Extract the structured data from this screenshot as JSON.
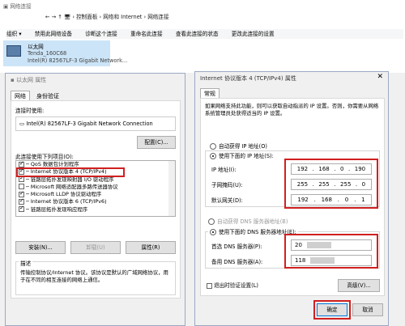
{
  "explorer": {
    "title": "网络连接",
    "breadcrumb": [
      "控制面板",
      "网络和 Internet",
      "网络连接"
    ],
    "toolbar": [
      "组织 ▾",
      "禁用此网络设备",
      "诊断这个连接",
      "重命名此连接",
      "查看此连接的状态",
      "更改此连接的设置"
    ],
    "adapter": {
      "name": "以太网",
      "network": "Tenda_160C68",
      "device": "Intel(R) 82567LF-3 Gigabit Network..."
    }
  },
  "eth": {
    "title": "以太网 属性",
    "tabs": [
      "网络",
      "身份验证"
    ],
    "connect_using_label": "连接时使用:",
    "adapter": "Intel(R) 82567LF-3 Gigabit Network Connection",
    "configure": "配置(C)...",
    "items_label": "此连接使用下列项目(O):",
    "items": [
      {
        "label": "QoS 数据包计划程序",
        "checked": true
      },
      {
        "label": "Internet 协议版本 4 (TCP/IPv4)",
        "checked": true
      },
      {
        "label": "链路层拓扑发现映射器 I/O 驱动程序",
        "checked": true
      },
      {
        "label": "Microsoft 网络适配器多路传送器协议",
        "checked": false
      },
      {
        "label": "Microsoft LLDP 协议驱动程序",
        "checked": true
      },
      {
        "label": "Internet 协议版本 6 (TCP/IPv6)",
        "checked": true
      },
      {
        "label": "链路层拓扑发现响应程序",
        "checked": true
      }
    ],
    "install": "安装(N)...",
    "uninstall": "卸载(U)",
    "properties": "属性(R)",
    "desc_title": "描述",
    "desc": "传输控制协议/Internet 协议。该协议是默认的广域网络协议，用于在不同的相互连接的网络上通信。"
  },
  "ipv4": {
    "title": "Internet 协议版本 4 (TCP/IPv4) 属性",
    "tab": "常规",
    "intro": "如果网络支持此功能，则可以获取自动指派的 IP 设置。否则，你需要从网络系统管理员处获得适当的 IP 设置。",
    "auto_ip": "自动获得 IP 地址(O)",
    "use_ip": "使用下面的 IP 地址(S):",
    "ip_label": "IP 地址(I):",
    "mask_label": "子网掩码(U):",
    "gw_label": "默认网关(D):",
    "ip": [
      "192",
      ".",
      "168",
      ".",
      "0",
      ".",
      "190"
    ],
    "mask": [
      "255",
      ".",
      "255",
      ".",
      "255",
      ".",
      "0"
    ],
    "gw": [
      "192",
      ".",
      "168",
      ".",
      "0",
      ".",
      "1"
    ],
    "auto_dns": "自动获得 DNS 服务器地址(B)",
    "use_dns": "使用下面的 DNS 服务器地址(E):",
    "dns1_label": "首选 DNS 服务器(P):",
    "dns2_label": "备用 DNS 服务器(A):",
    "dns1": "20",
    "dns2": "118",
    "validate": "退出时验证设置(L)",
    "advanced": "高级(V)...",
    "ok": "确定",
    "cancel": "取消"
  }
}
